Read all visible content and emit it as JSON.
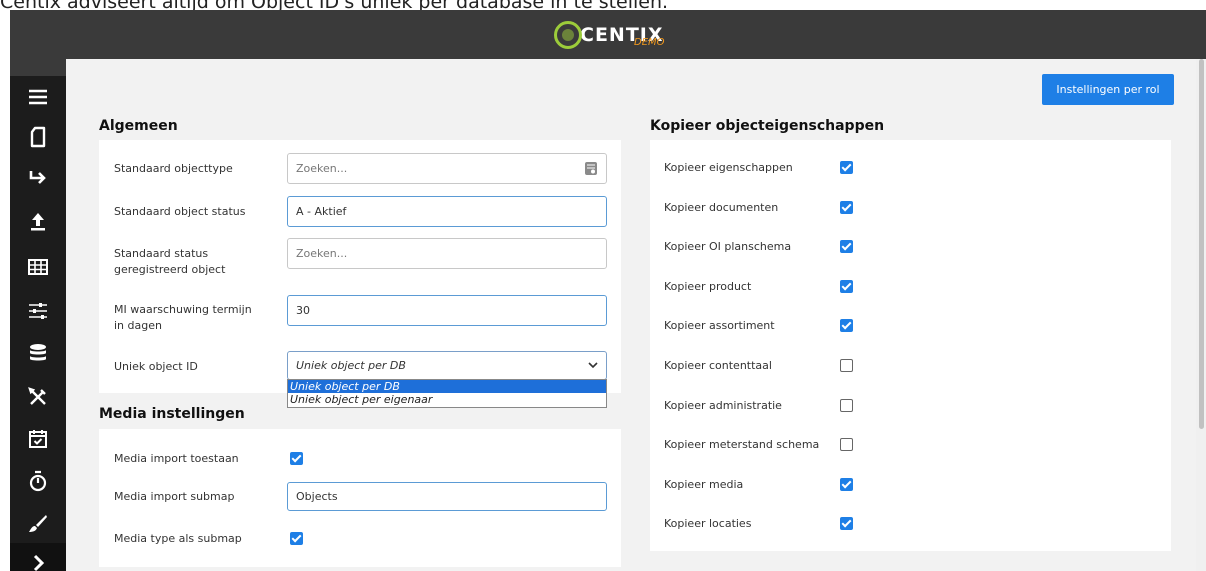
{
  "caption": "Centix adviseert altijd om Object ID's uniek per database in te stellen.",
  "brand": {
    "name": "CENTIX",
    "sub": "DEMO",
    "accent": "#9ccc3a",
    "sub_color": "#f39a1e"
  },
  "sidebar": {
    "icons": [
      "hamburger-menu-icon",
      "document-icon",
      "share-arrow-icon",
      "upload-icon",
      "grid-table-icon",
      "sliders-icon",
      "database-icon",
      "tools-icon",
      "calendar-check-icon",
      "stopwatch-icon",
      "paint-brush-icon",
      "chevron-right-icon"
    ]
  },
  "header_button": "Instellingen per rol",
  "algemeen": {
    "title": "Algemeen",
    "rows": [
      {
        "label": "Standaard objecttype",
        "value": "",
        "placeholder": "Zoeken..."
      },
      {
        "label": "Standaard object status",
        "value": "A - Aktief",
        "placeholder": ""
      },
      {
        "label": "Standaard status geregistreerd object",
        "value": "",
        "placeholder": "Zoeken..."
      },
      {
        "label": "MI waarschuwing termijn in dagen",
        "value": "30",
        "placeholder": ""
      },
      {
        "label": "Uniek object ID",
        "value": "Uniek object per DB",
        "placeholder": ""
      }
    ],
    "dropdown_options": [
      "Uniek object per DB",
      "Uniek object per eigenaar"
    ],
    "dropdown_selected": "Uniek object per DB"
  },
  "media": {
    "title": "Media instellingen",
    "rows": [
      {
        "label": "Media import toestaan",
        "checked": true
      },
      {
        "label": "Media import submap",
        "value": "Objects"
      },
      {
        "label": "Media type als submap",
        "checked": true
      }
    ]
  },
  "kopieer": {
    "title": "Kopieer objecteigenschappen",
    "rows": [
      {
        "label": "Kopieer eigenschappen",
        "checked": true
      },
      {
        "label": "Kopieer documenten",
        "checked": true
      },
      {
        "label": "Kopieer OI planschema",
        "checked": true
      },
      {
        "label": "Kopieer product",
        "checked": true
      },
      {
        "label": "Kopieer assortiment",
        "checked": true
      },
      {
        "label": "Kopieer contenttaal",
        "checked": false
      },
      {
        "label": "Kopieer administratie",
        "checked": false
      },
      {
        "label": "Kopieer meterstand schema",
        "checked": false
      },
      {
        "label": "Kopieer media",
        "checked": true
      },
      {
        "label": "Kopieer locaties",
        "checked": true
      }
    ]
  },
  "colors": {
    "primary": "#1e7fe6",
    "topbar": "#3a3a3a",
    "sidebar": "#1c1c1c",
    "content_bg": "#f2f2f2"
  }
}
